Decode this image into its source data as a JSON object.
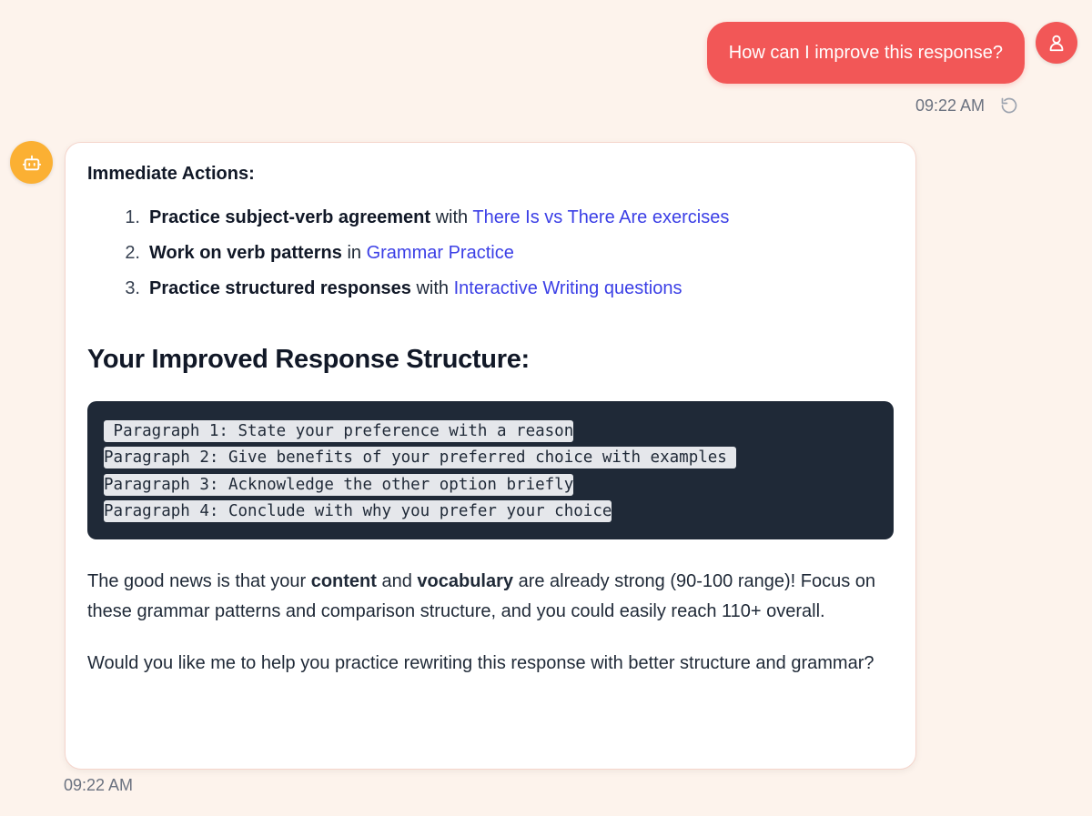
{
  "user_message": {
    "text": "How can I improve this response?",
    "time": "09:22 AM",
    "avatar_icon": "user-icon",
    "retry_icon": "retry-icon",
    "bubble_color": "#f25757"
  },
  "bot_message": {
    "avatar_icon": "robot-icon",
    "avatar_color": "#fbb033",
    "section_label": "Immediate Actions:",
    "actions": [
      {
        "num": "1.",
        "bold": "Practice subject-verb agreement",
        "connector": " with ",
        "link": "There Is vs There Are exercises"
      },
      {
        "num": "2.",
        "bold": "Work on verb patterns",
        "connector": " in ",
        "link": "Grammar Practice"
      },
      {
        "num": "3.",
        "bold": "Practice structured responses",
        "connector": " with ",
        "link": "Interactive Writing questions"
      }
    ],
    "heading": "Your Improved Response Structure:",
    "code_lines": [
      " Paragraph 1: State your preference with a reason",
      "Paragraph 2: Give benefits of your preferred choice with examples ",
      "Paragraph 3: Acknowledge the other option briefly",
      "Paragraph 4: Conclude with why you prefer your choice"
    ],
    "para1": {
      "part1": "The good news is that your ",
      "bold1": "content",
      "part2": " and ",
      "bold2": "vocabulary",
      "part3": " are already strong (90-100 range)! Focus on these grammar patterns and comparison structure, and you could easily reach 110+ overall."
    },
    "para2": "Would you like me to help you practice rewriting this response with better structure and grammar?",
    "time": "09:22 AM"
  },
  "colors": {
    "background": "#fdf3ec",
    "link": "#3b3fe6",
    "code_bg": "#1f2937"
  }
}
